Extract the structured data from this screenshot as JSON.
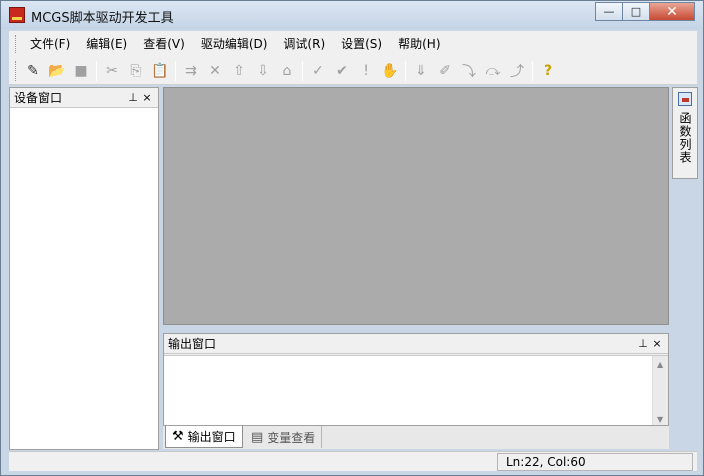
{
  "window": {
    "title": "MCGS脚本驱动开发工具",
    "controls": {
      "minimize": "—",
      "maximize": "□",
      "close": "✕"
    }
  },
  "menu": [
    {
      "label": "文件(F)"
    },
    {
      "label": "编辑(E)"
    },
    {
      "label": "查看(V)"
    },
    {
      "label": "驱动编辑(D)"
    },
    {
      "label": "调试(R)"
    },
    {
      "label": "设置(S)"
    },
    {
      "label": "帮助(H)"
    }
  ],
  "toolbar": {
    "icons": [
      "new-file-icon",
      "open-folder-icon",
      "save-icon",
      "cut-icon",
      "copy-icon",
      "paste-icon",
      "add-item-icon",
      "delete-icon",
      "move-up-icon",
      "move-down-icon",
      "properties-icon",
      "check-icon",
      "check-all-icon",
      "alert-icon",
      "hand-icon",
      "step-icon",
      "edit-icon",
      "step-into-icon",
      "step-over-icon",
      "step-out-icon",
      "help-icon"
    ],
    "glyphs": {
      "new": "✎",
      "open": "📂",
      "save": "■",
      "cut": "✂",
      "copy": "⎘",
      "paste": "📋",
      "add": "⇉",
      "delete": "✕",
      "up": "⇧",
      "down": "⇩",
      "props": "⌂",
      "check": "✓",
      "check_all": "✔",
      "alert": "!",
      "hand": "✋",
      "step": "⇓",
      "edit": "✐",
      "into": "⤵",
      "over": "⤼",
      "out": "⤴",
      "help": "?"
    }
  },
  "device_panel": {
    "title": "设备窗口",
    "pin": "⊥",
    "close": "×"
  },
  "side_tab": {
    "label": "函数列表"
  },
  "output_panel": {
    "title": "输出窗口",
    "pin": "⊥",
    "close": "×"
  },
  "bottom_tabs": [
    {
      "label": "输出窗口",
      "icon": "⚒",
      "active": true
    },
    {
      "label": "变量查看",
      "icon": "▤",
      "active": false
    }
  ],
  "status": {
    "position": "Ln:22, Col:60"
  }
}
